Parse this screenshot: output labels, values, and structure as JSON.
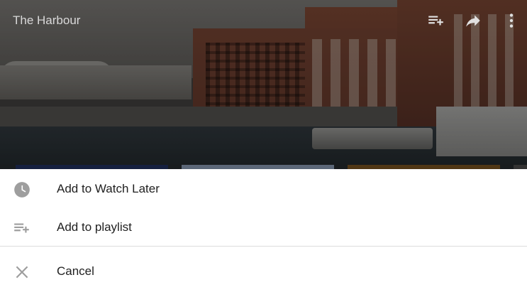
{
  "video": {
    "title": "The Harbour",
    "icons": [
      "add-to-queue-icon",
      "share-icon",
      "more-vert-icon"
    ]
  },
  "menu": {
    "items": [
      {
        "label": "Add to Watch Later",
        "icon": "clock-icon"
      },
      {
        "label": "Add to playlist",
        "icon": "playlist-add-icon"
      },
      {
        "label": "Cancel",
        "icon": "close-icon"
      }
    ]
  },
  "colors": {
    "icon_gray": "#9e9e9e",
    "text": "#212121",
    "divider": "#dcdcdc"
  }
}
